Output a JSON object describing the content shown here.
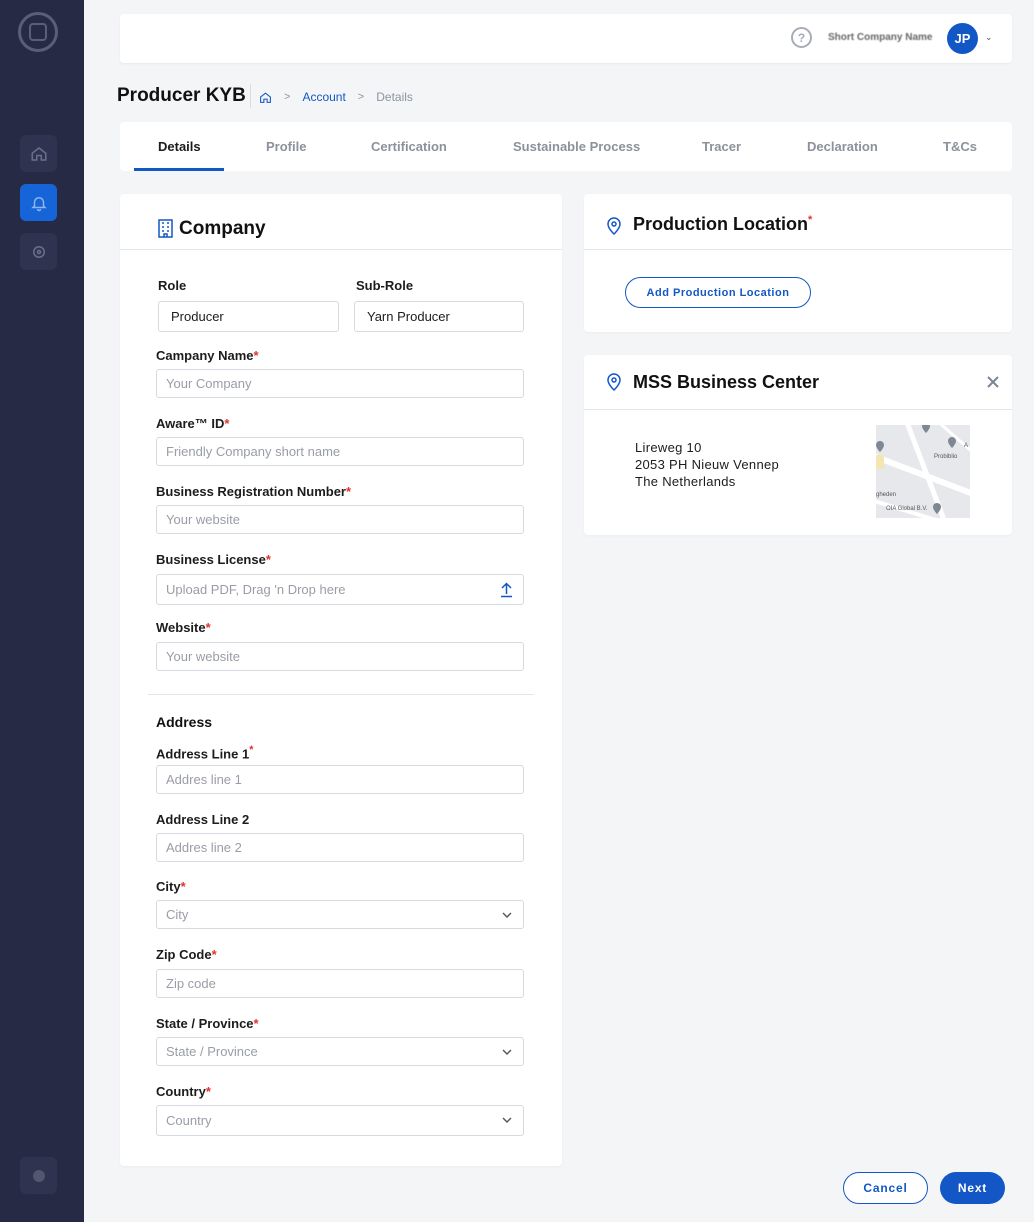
{
  "colors": {
    "accent": "#1357c6",
    "sidebar": "#272a45",
    "required": "#e0322e"
  },
  "topbar": {
    "company_name": "Short Company Name",
    "avatar_initials": "JP",
    "help_icon": "help-circle-icon"
  },
  "page": {
    "title": "Producer KYB"
  },
  "breadcrumb": {
    "home_icon": "home-icon",
    "account": "Account",
    "current": "Details"
  },
  "tabs": [
    "Details",
    "Profile",
    "Certification",
    "Sustainable Process",
    "Tracer",
    "Declaration",
    "T&Cs"
  ],
  "active_tab": "Details",
  "company": {
    "title": "Company",
    "role_label": "Role",
    "role_value": "Producer",
    "subrole_label": "Sub-Role",
    "subrole_value": "Yarn Producer",
    "company_name_label": "Campany Name",
    "company_name_placeholder": "Your Company",
    "aware_id_label": "Aware™ ID",
    "aware_id_placeholder": "Friendly Company short name",
    "brn_label": "Business Registration Number",
    "brn_placeholder": "Your website",
    "license_label": "Business License",
    "license_placeholder": "Upload PDF, Drag 'n Drop here",
    "website_label": "Website",
    "website_placeholder": "Your website",
    "required_mark": "*"
  },
  "address": {
    "title": "Address",
    "line1_label": "Address Line 1",
    "line1_placeholder": "Addres line 1",
    "line2_label": "Address Line 2",
    "line2_placeholder": "Addres line 2",
    "city_label": "City",
    "city_placeholder": "City",
    "zip_label": "Zip Code",
    "zip_placeholder": "Zip code",
    "state_label": "State / Province",
    "state_placeholder": "State / Province",
    "country_label": "Country",
    "country_placeholder": "Country"
  },
  "production": {
    "title": "Production Location",
    "add_button": "Add Production Location"
  },
  "location_card": {
    "title": "MSS Business Center",
    "address_lines": [
      "Lireweg 10",
      "2053 PH  Nieuw Vennep",
      "The Netherlands"
    ],
    "map_labels": [
      "Probiblio",
      "OIA Global B.V.",
      "gheden",
      "A"
    ]
  },
  "actions": {
    "cancel": "Cancel",
    "next": "Next"
  }
}
